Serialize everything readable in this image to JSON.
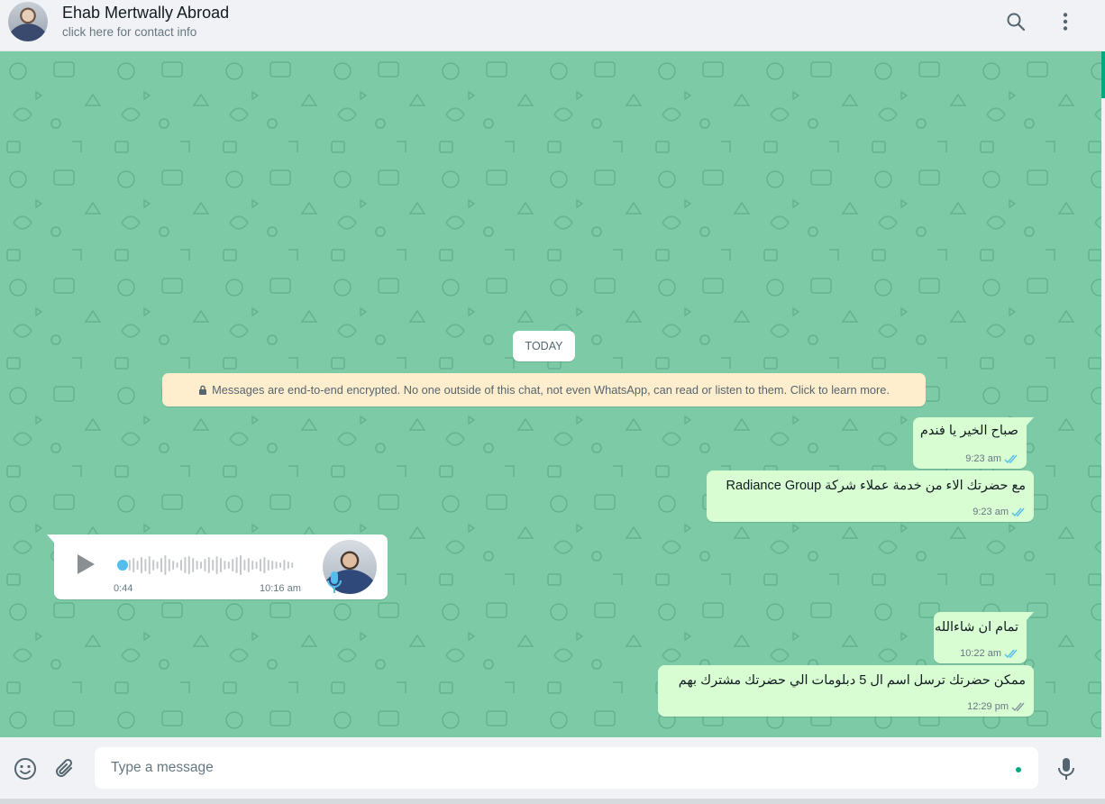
{
  "header": {
    "contact_name": "Ehab Mertwally Abroad",
    "contact_subtitle": "click here for contact info",
    "icons": [
      "search-icon",
      "menu-icon"
    ]
  },
  "chat": {
    "date_chip": "TODAY",
    "encryption_notice": "Messages are end-to-end encrypted. No one outside of this chat, not even WhatsApp, can read or listen to them. Click to learn more.",
    "messages": [
      {
        "direction": "out",
        "text": "صباح الخير يا فندم",
        "time": "9:23 am",
        "status": "read"
      },
      {
        "direction": "out",
        "text": "مع حضرتك الاء من خدمة عملاء شركة Radiance Group",
        "time": "9:23 am",
        "status": "read"
      },
      {
        "direction": "in",
        "type": "voice",
        "duration": "0:44",
        "time": "10:16 am"
      },
      {
        "direction": "out",
        "text": "تمام ان شاءالله",
        "time": "10:22 am",
        "status": "read"
      },
      {
        "direction": "out",
        "text": "ممكن حضرتك ترسل اسم ال 5 دبلومات الي حضرتك مشترك بهم",
        "time": "12:29 pm",
        "status": "delivered"
      }
    ]
  },
  "footer": {
    "placeholder": "Type a message",
    "value": "",
    "icons": [
      "emoji-icon",
      "attach-icon",
      "mic-icon"
    ]
  },
  "colors": {
    "chat_background": "#7dcaa6",
    "outgoing_bubble": "#d9fdd3",
    "incoming_bubble": "#ffffff",
    "read_ticks": "#53bdeb",
    "accent": "#00a884",
    "header_background": "#f0f2f5"
  }
}
